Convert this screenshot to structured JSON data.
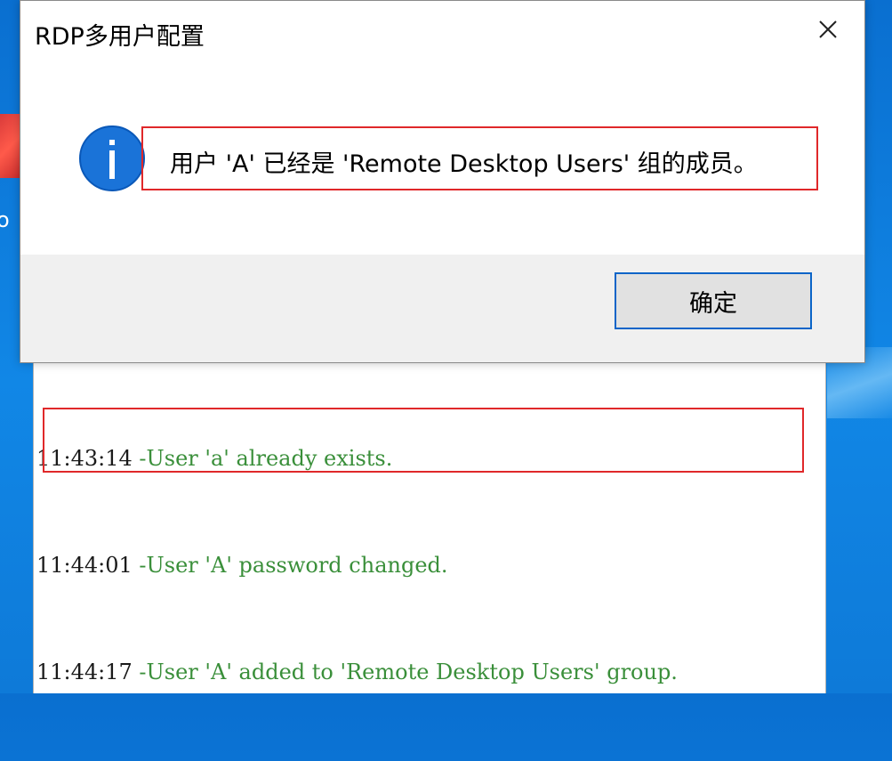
{
  "dialog": {
    "title": "RDP多用户配置",
    "message": "用户 'A' 已经是 'Remote Desktop Users' 组的成员。",
    "ok_label": "确定"
  },
  "desktop": {
    "partial_label": "o"
  },
  "log": {
    "lines": [
      {
        "time": "11:43:14",
        "message": " -User 'a' already exists."
      },
      {
        "time": "11:44:01",
        "message": " -User 'A' password changed."
      },
      {
        "time": "11:44:17",
        "message": " -User 'A' added to 'Remote Desktop Users' group."
      }
    ]
  },
  "colors": {
    "accent": "#1a73d8",
    "log_message": "#3a8f3a",
    "highlight_box": "#e0282a"
  }
}
